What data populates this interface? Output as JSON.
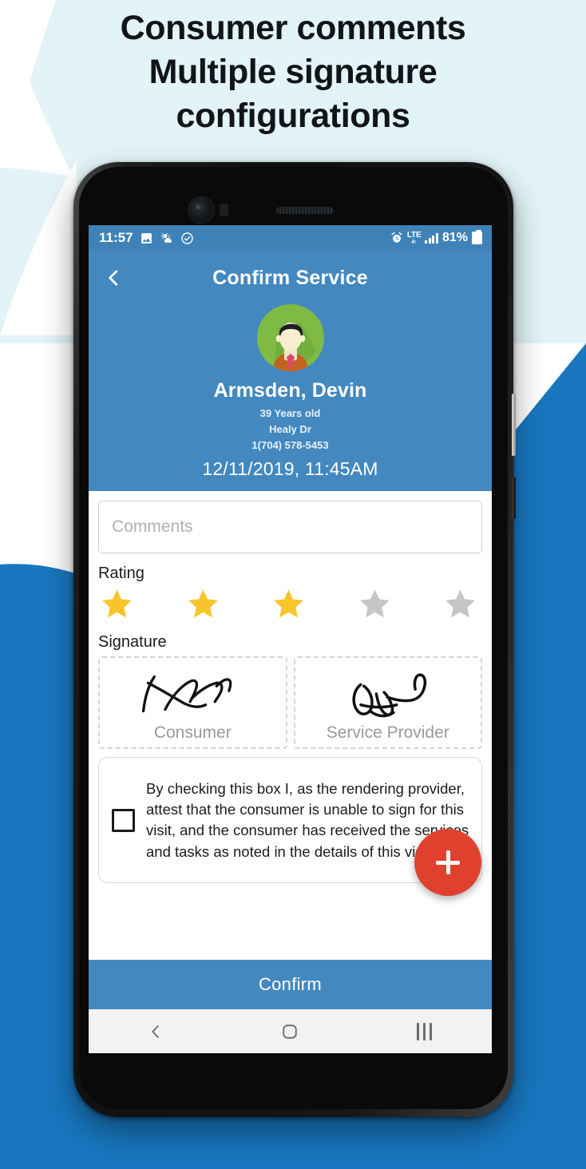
{
  "promo": {
    "lines": [
      "Consumer comments",
      "Multiple signature",
      "configurations"
    ]
  },
  "colors": {
    "page_bg": "#ffffff",
    "pale_cyan": "#e2f4f7",
    "brand_blue": "#1877bf",
    "app_header_blue": "#4388bf",
    "statusbar_blue": "#3f82b7",
    "fab_red": "#e0412f",
    "star_filled": "#f7c52b",
    "star_empty": "#c6c6c6",
    "avatar_bg": "#7fba45"
  },
  "statusbar": {
    "time": "11:57",
    "left_icons": [
      "image-icon",
      "weather-icon",
      "check-circle-icon"
    ],
    "alarm_icon": "alarm-icon",
    "network_label": "LTE",
    "network_sub": "4↑",
    "signal_icon": "signal-bars-icon",
    "battery_percent": "81%",
    "battery_icon": "battery-icon"
  },
  "appbar": {
    "back_icon": "chevron-left-icon",
    "title": "Confirm Service"
  },
  "patient": {
    "avatar_icon": "user-avatar",
    "name": "Armsden, Devin",
    "age": "39 Years old",
    "address": "Healy Dr",
    "phone": "1(704) 578-5453",
    "visit_datetime": "12/11/2019, 11:45AM"
  },
  "form": {
    "comments": {
      "value": "",
      "placeholder": "Comments"
    },
    "rating": {
      "label": "Rating",
      "value": 3,
      "max": 5
    },
    "signature": {
      "label": "Signature",
      "boxes": [
        {
          "caption": "Consumer",
          "signed": true
        },
        {
          "caption": "Service Provider",
          "signed": true
        }
      ]
    },
    "attestation": {
      "checked": false,
      "text": "By checking this box I, as the rendering provider, attest that the consumer is unable to sign for this visit, and the consumer has received the services and tasks as noted in the details of this visit."
    },
    "fab": {
      "icon": "plus-icon",
      "label": "+"
    }
  },
  "footer": {
    "confirm_label": "Confirm"
  },
  "navbar": {
    "back_icon": "nav-back-icon",
    "home_icon": "nav-home-icon",
    "recents_icon": "nav-recents-icon"
  }
}
